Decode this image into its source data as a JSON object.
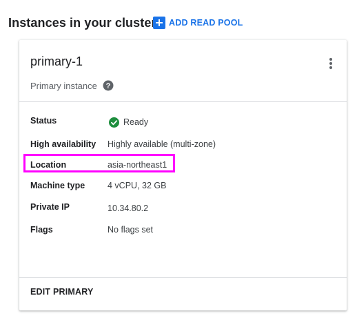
{
  "header": {
    "title": "Instances in your cluster",
    "add_read_pool_label": "ADD READ POOL"
  },
  "card": {
    "title": "primary-1",
    "subtitle": "Primary instance",
    "rows": [
      {
        "label": "Status",
        "value": "Ready",
        "icon": "check-circle-icon"
      },
      {
        "label": "High availability",
        "value": "Highly available (multi-zone)"
      },
      {
        "label": "Location",
        "value": "asia-northeast1"
      },
      {
        "label": "Machine type",
        "value": "4 vCPU, 32 GB"
      },
      {
        "label": "Private IP",
        "value": "10.34.80.2"
      },
      {
        "label": "Flags",
        "value": "No flags set"
      }
    ],
    "edit_label": "EDIT PRIMARY"
  },
  "colors": {
    "accent": "#1a73e8",
    "ready_green": "#1e8e3e",
    "highlight": "#ff00ff"
  }
}
